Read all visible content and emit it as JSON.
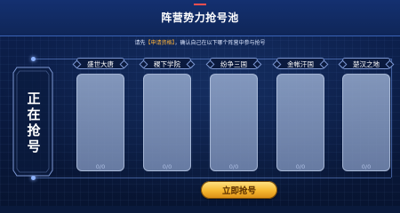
{
  "header": {
    "title": "阵营势力抢号池"
  },
  "instruction": {
    "prefix": "请先",
    "highlight": "【申请资格】",
    "suffix": "，确认自己在以下哪个阵营中参与抢号"
  },
  "status": {
    "text": "正在抢号"
  },
  "factions": [
    {
      "name": "盛世大唐",
      "count": "0/0"
    },
    {
      "name": "稷下学院",
      "count": "0/0"
    },
    {
      "name": "纷争三国",
      "count": "0/0"
    },
    {
      "name": "金帐汗国",
      "count": "0/0"
    },
    {
      "name": "楚汉之地",
      "count": "0/0"
    }
  ],
  "actions": {
    "grab_label": "立即抢号"
  },
  "colors": {
    "accent": "#f6b830",
    "background": "#0a1a3c",
    "card": "#8b9cc0"
  }
}
